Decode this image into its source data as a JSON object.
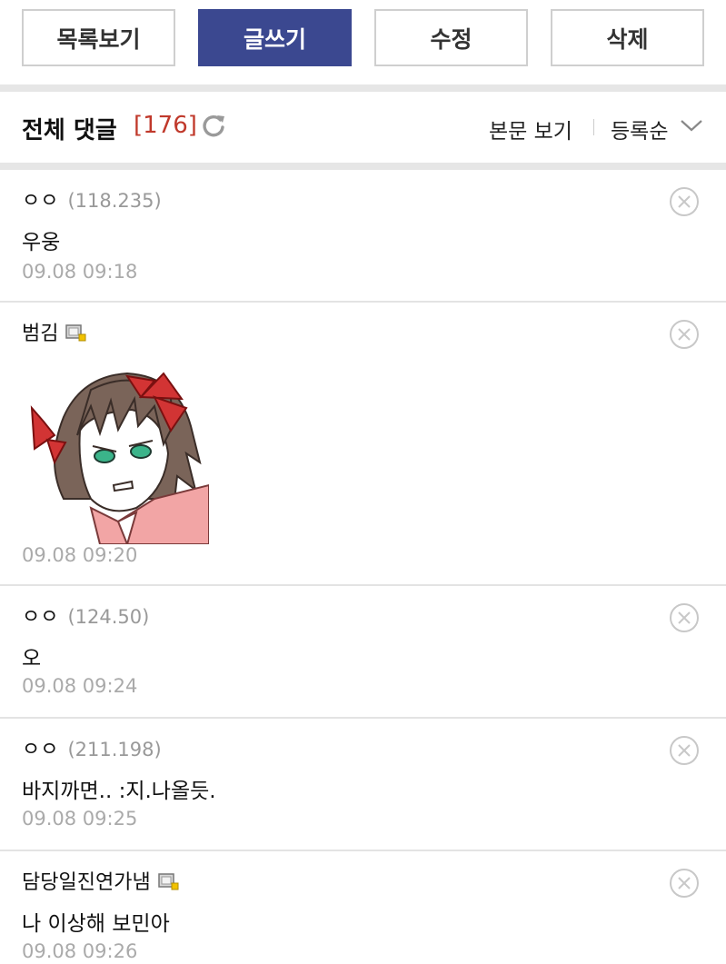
{
  "toolbar": {
    "list_label": "목록보기",
    "write_label": "글쓰기",
    "edit_label": "수정",
    "delete_label": "삭제"
  },
  "comments_header": {
    "title": "전체 댓글",
    "count": "[176]",
    "view_body": "본문 보기",
    "sort": "등록순"
  },
  "comments": [
    {
      "name": "ㅇㅇ",
      "ip": "(118.235)",
      "body": "우웅",
      "date": "09.08 09:18"
    },
    {
      "name": "범김",
      "ip": "",
      "body": "",
      "date": "09.08 09:20"
    },
    {
      "name": "ㅇㅇ",
      "ip": "(124.50)",
      "body": "오",
      "date": "09.08 09:24"
    },
    {
      "name": "ㅇㅇ",
      "ip": "(211.198)",
      "body": "바지까면.. :지.나올듯.",
      "date": "09.08 09:25"
    },
    {
      "name": "담당일진연가냄",
      "ip": "",
      "body": "나 이상해 보민아",
      "date": "09.08 09:26"
    }
  ],
  "colors": {
    "accent": "#3b4890",
    "count_red": "#c0392b",
    "meta_gray": "#999999"
  }
}
